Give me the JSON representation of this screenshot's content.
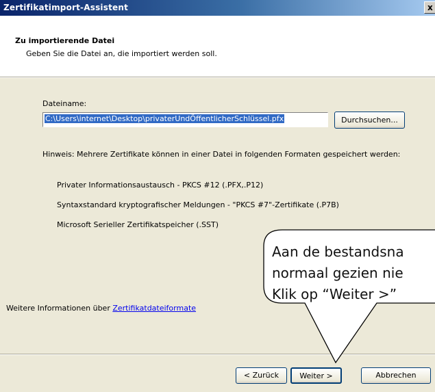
{
  "window": {
    "title": "Zertifikatimport-Assistent",
    "close_glyph": "x"
  },
  "header": {
    "title": "Zu importierende Datei",
    "subtitle": "Geben Sie die Datei an, die importiert werden soll."
  },
  "file": {
    "label": "Dateiname:",
    "value": "C:\\Users\\internet\\Desktop\\privaterUndÖffentlicherSchlüssel.pfx",
    "browse_label": "Durchsuchen..."
  },
  "hint": {
    "text": "Hinweis: Mehrere Zertifikate können in einer Datei in folgenden Formaten gespeichert werden:",
    "formats": [
      "Privater Informationsaustausch - PKCS #12 (.PFX,.P12)",
      "Syntaxstandard kryptografischer Meldungen - \"PKCS #7\"-Zertifikate (.P7B)",
      "Microsoft Serieller Zertifikatspeicher (.SST)"
    ]
  },
  "more_info": {
    "prefix": "Weitere Informationen über ",
    "link": "Zertifikatdateiformate"
  },
  "buttons": {
    "back": "< Zurück",
    "next": "Weiter >",
    "cancel": "Abbrechen"
  },
  "callout": {
    "lines": [
      "Aan de bestandsna",
      "normaal gezien nie",
      "Klik op “Weiter >”"
    ]
  }
}
